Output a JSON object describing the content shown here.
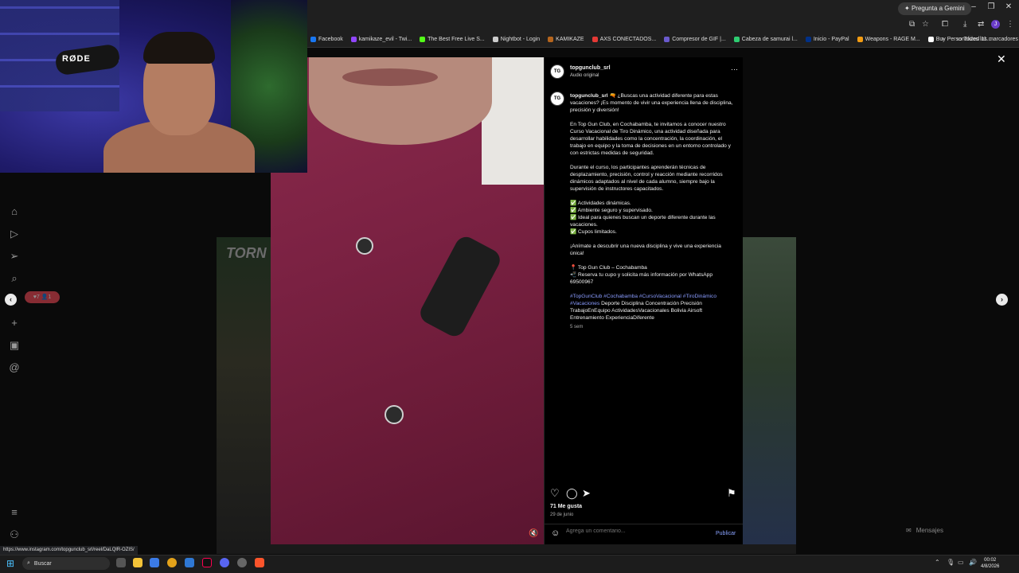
{
  "browser": {
    "gemini_label": "Pregunta a Gemini",
    "bookmarks": [
      {
        "label": "Facebook",
        "color": "#1877f2"
      },
      {
        "label": "kamikaze_evil - Twi...",
        "color": "#9146ff"
      },
      {
        "label": "The Best Free Live S...",
        "color": "#53fc18"
      },
      {
        "label": "Nightbot - Login",
        "color": "#cccccc"
      },
      {
        "label": "KAMIKAZE",
        "color": "#b5651d"
      },
      {
        "label": "AXS CONECTADOS...",
        "color": "#e53935"
      },
      {
        "label": "Compresor de GIF |...",
        "color": "#6a5acd"
      },
      {
        "label": "Cabeza de samurai l...",
        "color": "#2ecc71"
      },
      {
        "label": "Inicio - PayPal",
        "color": "#003087"
      },
      {
        "label": "Weapons - RAGE M...",
        "color": "#f39c12"
      },
      {
        "label": "Buy Personalized 11...",
        "color": "#ffffff"
      }
    ],
    "all_bookmarks_label": "Todos los marcadores",
    "status_url": "https://www.instagram.com/topgunclub_srl/reel/DaLQlR-OZIS/"
  },
  "webcam": {
    "mic_brand": "RØDE"
  },
  "post": {
    "username": "topgunclub_srl",
    "audio": "Audio original",
    "caption_user": "topgunclub_srl",
    "caption_intro": "🔫 ¿Buscas una actividad diferente para estas vacaciones? ¡Es momento de vivir una experiencia llena de disciplina, precisión y diversión!",
    "p2": "En Top Gun Club, en Cochabamba, te invitamos a conocer nuestro Curso Vacacional de Tiro Dinámico, una actividad diseñada para desarrollar habilidades como la concentración, la coordinación, el trabajo en equipo y la toma de decisiones en un entorno controlado y con estrictas medidas de seguridad.",
    "p3": "Durante el curso, los participantes aprenderán técnicas de desplazamiento, precisión, control y reacción mediante recorridos dinámicos adaptados al nivel de cada alumno, siempre bajo la supervisión de instructores capacitados.",
    "bullet1": "✅ Actividades dinámicas.",
    "bullet2": "✅ Ambiente seguro y supervisado.",
    "bullet3": "✅ Ideal para quienes buscan un deporte diferente durante las vacaciones.",
    "bullet4": "✅ Cupos limitados.",
    "p5": "¡Anímate a descubrir una nueva disciplina y vive una experiencia única!",
    "location": "📍 Top Gun Club – Cochabamba",
    "contact": "📲 Reserva tu cupo y solicita más información por WhatsApp 69500967",
    "hashtags": "#TopGunClub #Cochabamba #CursoVacacional #TiroDinámico #Vacaciones",
    "keywords": "Deporte Disciplina Concentración Precisión TrabajoEnEquipo ActividadesVacacionales Bolivia Airsoft Entrenamiento ExperienciaDiferente",
    "age": "5 sem",
    "likes": "71 Me gusta",
    "date": "29 de junio",
    "comment_placeholder": "Agrega un comentario...",
    "publish_label": "Publicar"
  },
  "background": {
    "grid_text": "TORN",
    "notif_text": "♥7 👤1"
  },
  "messages_label": "Mensajes",
  "taskbar": {
    "search_label": "Buscar",
    "time": "00:02",
    "date": "4/8/2026"
  }
}
